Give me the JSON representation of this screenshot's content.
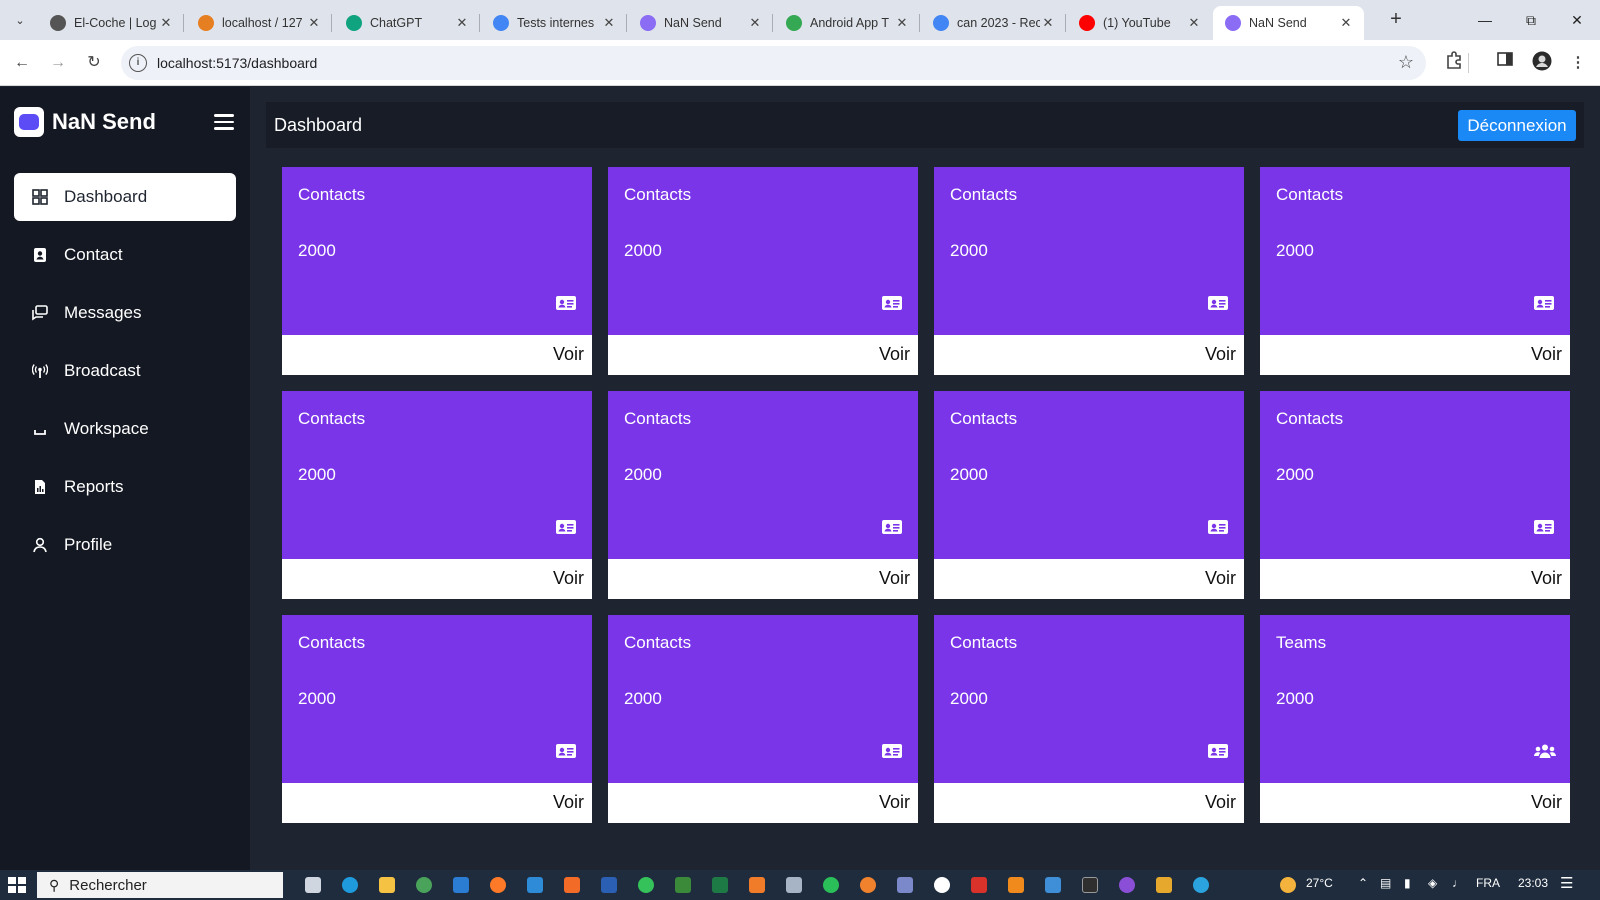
{
  "browser": {
    "tabs": [
      {
        "title": "El-Coche | Log",
        "favicon_color": "#555555"
      },
      {
        "title": "localhost / 127",
        "favicon_color": "#e67e22"
      },
      {
        "title": "ChatGPT",
        "favicon_color": "#10a37f"
      },
      {
        "title": "Tests internes",
        "favicon_color": "#4285f4"
      },
      {
        "title": "NaN Send",
        "favicon_color": "#8a6cf5"
      },
      {
        "title": "Android App T",
        "favicon_color": "#34a853"
      },
      {
        "title": "can 2023 - Rec",
        "favicon_color": "#4285f4"
      },
      {
        "title": "(1) YouTube",
        "favicon_color": "#ff0000"
      },
      {
        "title": "NaN Send",
        "favicon_color": "#8a6cf5",
        "active": true
      }
    ],
    "url": "localhost:5173/dashboard"
  },
  "app": {
    "brand": "NaN Send",
    "page_title": "Dashboard",
    "logout_label": "Déconnexion",
    "accent_color": "#7b35e8",
    "button_color": "#1a88f5",
    "menu": [
      {
        "label": "Dashboard",
        "icon": "grid-icon",
        "active": true
      },
      {
        "label": "Contact",
        "icon": "address-book-icon"
      },
      {
        "label": "Messages",
        "icon": "messages-icon"
      },
      {
        "label": "Broadcast",
        "icon": "broadcast-icon"
      },
      {
        "label": "Workspace",
        "icon": "workspace-icon"
      },
      {
        "label": "Reports",
        "icon": "report-file-icon"
      },
      {
        "label": "Profile",
        "icon": "user-icon"
      }
    ],
    "cards": [
      {
        "title": "Contacts",
        "value": "2000",
        "icon": "id-card-icon",
        "link": "Voir"
      },
      {
        "title": "Contacts",
        "value": "2000",
        "icon": "id-card-icon",
        "link": "Voir"
      },
      {
        "title": "Contacts",
        "value": "2000",
        "icon": "id-card-icon",
        "link": "Voir"
      },
      {
        "title": "Contacts",
        "value": "2000",
        "icon": "id-card-icon",
        "link": "Voir"
      },
      {
        "title": "Contacts",
        "value": "2000",
        "icon": "id-card-icon",
        "link": "Voir"
      },
      {
        "title": "Contacts",
        "value": "2000",
        "icon": "id-card-icon",
        "link": "Voir"
      },
      {
        "title": "Contacts",
        "value": "2000",
        "icon": "id-card-icon",
        "link": "Voir"
      },
      {
        "title": "Contacts",
        "value": "2000",
        "icon": "id-card-icon",
        "link": "Voir"
      },
      {
        "title": "Contacts",
        "value": "2000",
        "icon": "id-card-icon",
        "link": "Voir"
      },
      {
        "title": "Contacts",
        "value": "2000",
        "icon": "id-card-icon",
        "link": "Voir"
      },
      {
        "title": "Contacts",
        "value": "2000",
        "icon": "id-card-icon",
        "link": "Voir"
      },
      {
        "title": "Teams",
        "value": "2000",
        "icon": "users-icon",
        "link": "Voir"
      }
    ]
  },
  "taskbar": {
    "search_placeholder": "Rechercher",
    "temperature": "27°C",
    "language": "FRA",
    "time": "23:03"
  }
}
